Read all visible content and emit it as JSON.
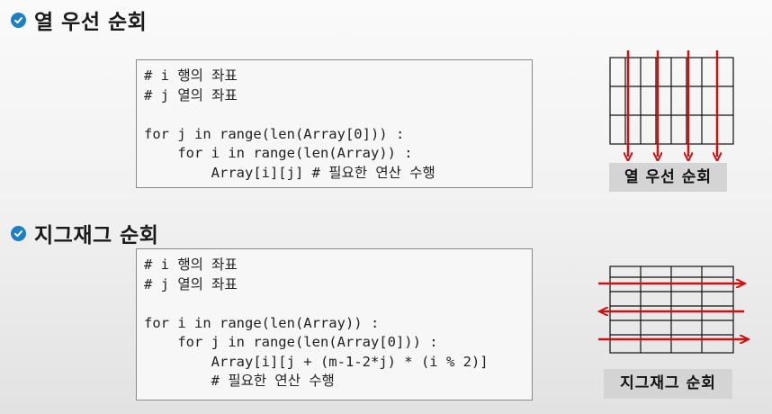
{
  "section1": {
    "title": "열 우선 순회",
    "code_lines": [
      "# i 행의 좌표",
      "# j 열의 좌표",
      "",
      "for j in range(len(Array[0])) :",
      "    for i in range(len(Array)) :",
      "        Array[i][j] # 필요한 연산 수행"
    ],
    "caption": "열 우선 순회"
  },
  "section2": {
    "title": "지그재그 순회",
    "code_lines": [
      "# i 행의 좌표",
      "# j 열의 좌표",
      "",
      "for i in range(len(Array)) :",
      "    for j in range(len(Array[0])) :",
      "        Array[i][j + (m-1-2*j) * (i % 2)]",
      "        # 필요한 연산 수행"
    ],
    "caption": "지그재그 순회"
  },
  "colors": {
    "check_badge": "#1f7fc4",
    "arrow": "#cc1111",
    "grid_line": "#111111",
    "caption_bg": "#d4d4d4"
  }
}
